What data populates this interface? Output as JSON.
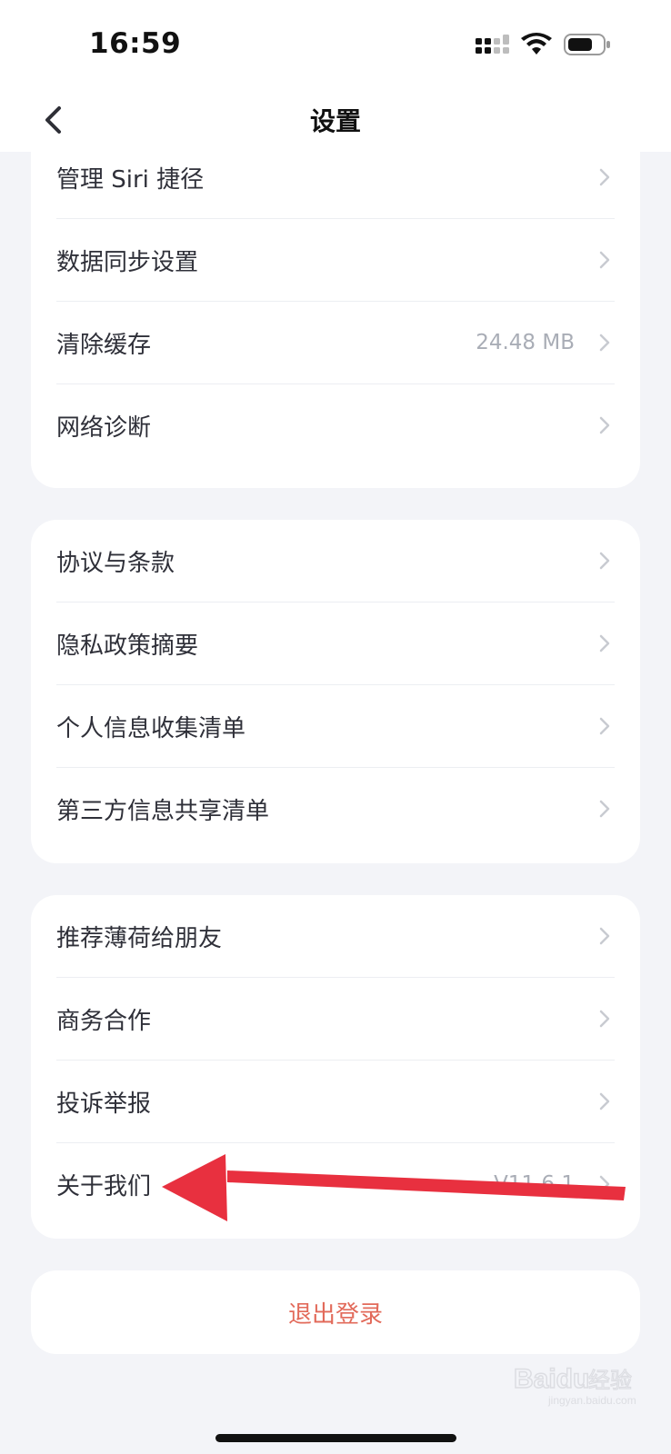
{
  "status_bar": {
    "time": "16:59"
  },
  "nav": {
    "title": "设置"
  },
  "group1": [
    {
      "label": "管理 Siri 捷径",
      "value": ""
    },
    {
      "label": "数据同步设置",
      "value": ""
    },
    {
      "label": "清除缓存",
      "value": "24.48 MB"
    },
    {
      "label": "网络诊断",
      "value": ""
    }
  ],
  "group2": [
    {
      "label": "协议与条款"
    },
    {
      "label": "隐私政策摘要"
    },
    {
      "label": "个人信息收集清单"
    },
    {
      "label": "第三方信息共享清单"
    }
  ],
  "group3": [
    {
      "label": "推荐薄荷给朋友",
      "value": ""
    },
    {
      "label": "商务合作",
      "value": ""
    },
    {
      "label": "投诉举报",
      "value": ""
    },
    {
      "label": "关于我们",
      "value": "V11.6.1"
    }
  ],
  "logout_label": "退出登录",
  "watermark": {
    "text": "Baidu经验",
    "subtext": "jingyan.baidu.com"
  },
  "colors": {
    "accent_red": "#e26a5a",
    "arrow_red": "#e8303f",
    "background": "#f3f4f8"
  }
}
